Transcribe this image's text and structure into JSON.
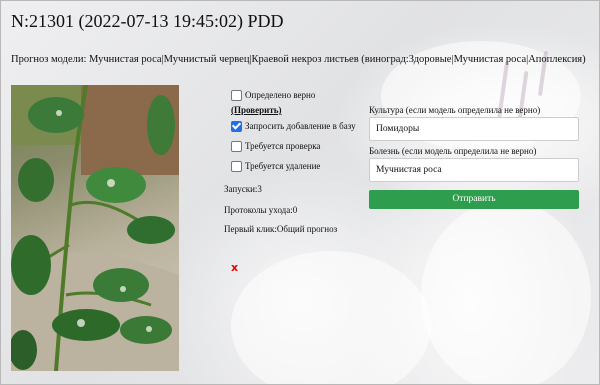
{
  "header": {
    "title": "N:21301 (2022-07-13 19:45:02) PDD"
  },
  "forecast_text": "Прогноз модели: Мучнистая роса|Мучнистый червец|Краевой некроз листьев (виноград:Здоровые|Мучнистая роса|Апоплексия)",
  "checks": {
    "determined_correctly": "Определено верно",
    "check_link": "(Проверить)",
    "request_add": "Запросить добавление в базу",
    "needs_check": "Требуется проверка",
    "needs_delete": "Требуется удаление",
    "request_add_checked": true
  },
  "stats": {
    "launches": "Запуски:3",
    "care_protocols": "Протоколы ухода:0",
    "first_click": "Первый клик:Общий прогноз"
  },
  "delete_mark": "x",
  "form": {
    "culture_label": "Культура (если модель определила не верно)",
    "culture_value": "Помидоры",
    "disease_label": "Болезнь (если модель определила не верно)",
    "disease_value": "Мучнистая роса",
    "submit_label": "Отправить"
  },
  "colors": {
    "submit": "#2e9d4d",
    "checkbox": "#1f6feb",
    "delete_mark": "#ee0000"
  }
}
